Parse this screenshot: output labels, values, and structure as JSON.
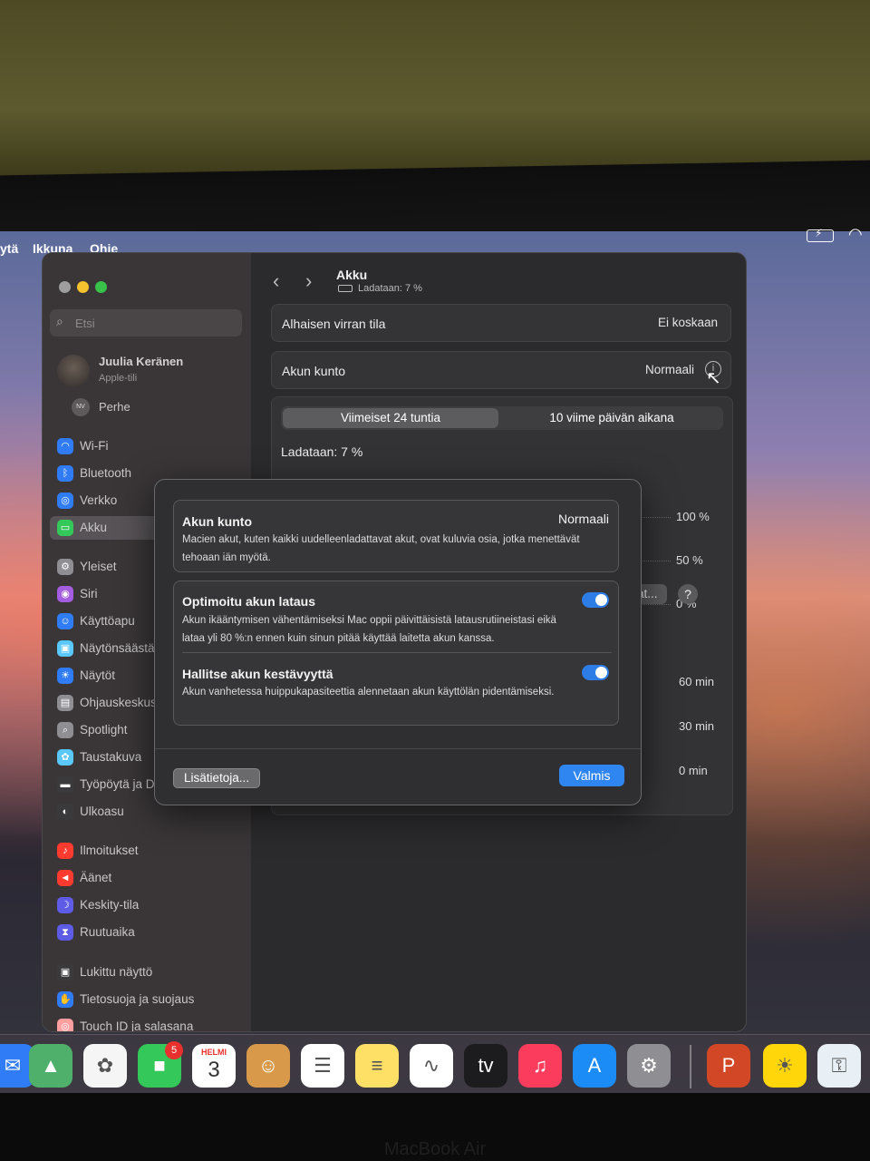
{
  "menubar": {
    "item_prev": "ytä",
    "item_window": "Ikkuna",
    "item_help": "Ohje"
  },
  "sidebar": {
    "search_placeholder": "Etsi",
    "user_name": "Juulia Keränen",
    "user_sub": "Apple-tili",
    "family_initials": "NV",
    "family_label": "Perhe",
    "items": [
      {
        "label": "Wi-Fi",
        "icon": "wifi-icon",
        "color": "#2f7cf6"
      },
      {
        "label": "Bluetooth",
        "icon": "bluetooth-icon",
        "color": "#2f7cf6"
      },
      {
        "label": "Verkko",
        "icon": "globe-icon",
        "color": "#2f7cf6"
      },
      {
        "label": "Akku",
        "icon": "battery-icon",
        "color": "#34c759"
      },
      {
        "label": "Yleiset",
        "icon": "gear-icon",
        "color": "#8e8e93"
      },
      {
        "label": "Siri",
        "icon": "siri-icon",
        "color": "#a45de0"
      },
      {
        "label": "Käyttöapu",
        "icon": "accessibility-icon",
        "color": "#2f7cf6"
      },
      {
        "label": "Näytönsäästäjä",
        "icon": "screensaver-icon",
        "color": "#5ac8fa"
      },
      {
        "label": "Näytöt",
        "icon": "sun-icon",
        "color": "#2f7cf6"
      },
      {
        "label": "Ohjauskeskus",
        "icon": "control-center-icon",
        "color": "#8e8e93"
      },
      {
        "label": "Spotlight",
        "icon": "search-icon",
        "color": "#8e8e93"
      },
      {
        "label": "Taustakuva",
        "icon": "wallpaper-icon",
        "color": "#5ac8fa"
      },
      {
        "label": "Työpöytä ja Dock",
        "icon": "desktop-icon",
        "color": "#3a3a3c"
      },
      {
        "label": "Ulkoasu",
        "icon": "appearance-icon",
        "color": "#3a3a3c"
      },
      {
        "label": "Ilmoitukset",
        "icon": "bell-icon",
        "color": "#ff3b30"
      },
      {
        "label": "Äänet",
        "icon": "speaker-icon",
        "color": "#ff3b30"
      },
      {
        "label": "Keskity-tila",
        "icon": "moon-icon",
        "color": "#5e5ce6"
      },
      {
        "label": "Ruutuaika",
        "icon": "hourglass-icon",
        "color": "#5e5ce6"
      },
      {
        "label": "Lukittu näyttö",
        "icon": "lock-icon",
        "color": "#3a3a3c"
      },
      {
        "label": "Tietosuoja ja suojaus",
        "icon": "hand-icon",
        "color": "#2f7cf6"
      },
      {
        "label": "Touch ID ja salasana",
        "icon": "fingerprint-icon",
        "color": "#ff9f9f"
      }
    ]
  },
  "header": {
    "title": "Akku",
    "subtitle": "Ladataan: 7 %"
  },
  "low_power": {
    "label": "Alhaisen virran tila",
    "value": "Ei koskaan"
  },
  "battery_health": {
    "label": "Akun kunto",
    "value": "Normaali"
  },
  "usage": {
    "tab_24h": "Viimeiset 24 tuntia",
    "tab_10d": "10 viime päivän aikana",
    "charging": "Ladataan: 7 %",
    "axis_pct": [
      "100 %",
      "50 %",
      "0 %"
    ],
    "axis_min": [
      "60 min",
      "30 min",
      "0 min"
    ]
  },
  "buttons": {
    "options": "Valinnat...",
    "help": "?"
  },
  "sheet": {
    "health_title": "Akun kunto",
    "health_value": "Normaali",
    "health_desc": "Macien akut, kuten kaikki uudelleenladattavat akut, ovat kuluvia osia, jotka menettävät tehoaan iän myötä.",
    "opt_title": "Optimoitu akun lataus",
    "opt_desc": "Akun ikääntymisen vähentämiseksi Mac oppii päivittäisistä latausrutiineistasi eikä lataa yli 80 %:n ennen kuin sinun pitää käyttää laitetta akun kanssa.",
    "opt_enabled": true,
    "manage_title": "Hallitse akun kestävyyttä",
    "manage_desc": "Akun vanhetessa huippukapasiteettia alennetaan akun käyttölän pidentämiseksi.",
    "manage_enabled": true,
    "more_btn": "Lisätietoja...",
    "done_btn": "Valmis"
  },
  "dock": {
    "calendar_month": "HELMI",
    "calendar_day": "3",
    "facetime_badge": "5",
    "apps": [
      "mail-icon",
      "maps-icon",
      "photos-icon",
      "facetime-icon",
      "calendar-icon",
      "contacts-icon",
      "reminders-icon",
      "notes-icon",
      "freeform-icon",
      "tv-icon",
      "music-icon",
      "appstore-icon",
      "system-settings-icon",
      "powerpoint-icon",
      "tips-icon",
      "keychain-icon"
    ]
  },
  "hardware_label": "MacBook Air"
}
